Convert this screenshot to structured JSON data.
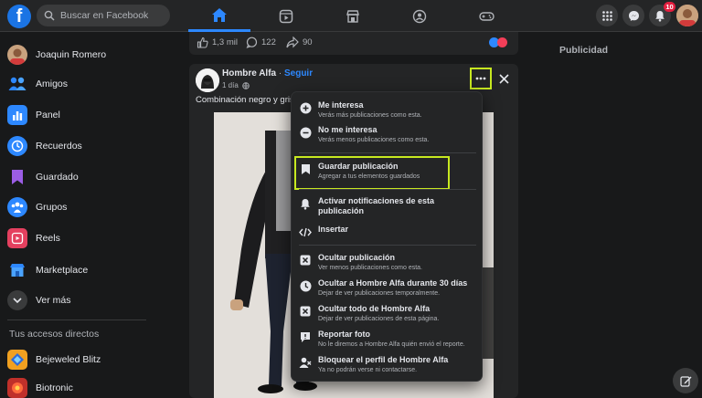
{
  "search": {
    "placeholder": "Buscar en Facebook"
  },
  "notifications": {
    "count": "10"
  },
  "sidebar": {
    "items": [
      {
        "label": "Joaquin Romero"
      },
      {
        "label": "Amigos"
      },
      {
        "label": "Panel"
      },
      {
        "label": "Recuerdos"
      },
      {
        "label": "Guardado"
      },
      {
        "label": "Grupos"
      },
      {
        "label": "Reels"
      },
      {
        "label": "Marketplace"
      },
      {
        "label": "Ver más"
      }
    ],
    "shortcuts_title": "Tus accesos directos",
    "shortcuts": [
      {
        "label": "Bejeweled Blitz"
      },
      {
        "label": "Biotronic"
      }
    ]
  },
  "prev_post": {
    "likes": "1,3 mil",
    "comments": "122",
    "shares": "90"
  },
  "post": {
    "author": "Hombre Alfa",
    "separator": " · ",
    "follow": "Seguir",
    "time": "1 día",
    "caption": "Combinación negro y gris"
  },
  "menu": {
    "items": [
      {
        "title": "Me interesa",
        "subtitle": "Verás más publicaciones como esta."
      },
      {
        "title": "No me interesa",
        "subtitle": "Verás menos publicaciones como esta."
      },
      {
        "title": "Guardar publicación",
        "subtitle": "Agregar a tus elementos guardados"
      },
      {
        "title": "Activar notificaciones de esta publicación",
        "subtitle": ""
      },
      {
        "title": "Insertar",
        "subtitle": ""
      },
      {
        "title": "Ocultar publicación",
        "subtitle": "Ver menos publicaciones como esta."
      },
      {
        "title": "Ocultar a Hombre Alfa durante 30 días",
        "subtitle": "Dejar de ver publicaciones temporalmente."
      },
      {
        "title": "Ocultar todo de Hombre Alfa",
        "subtitle": "Dejar de ver publicaciones de esta página."
      },
      {
        "title": "Reportar foto",
        "subtitle": "No le diremos a Hombre Alfa quién envió el reporte."
      },
      {
        "title": "Bloquear el perfil de Hombre Alfa",
        "subtitle": "Ya no podrán verse ni contactarse."
      }
    ]
  },
  "right": {
    "ads_title": "Publicidad"
  },
  "colors": {
    "accent": "#2d88ff",
    "highlight": "#c7e820",
    "background": "#18191a",
    "surface": "#242526"
  }
}
